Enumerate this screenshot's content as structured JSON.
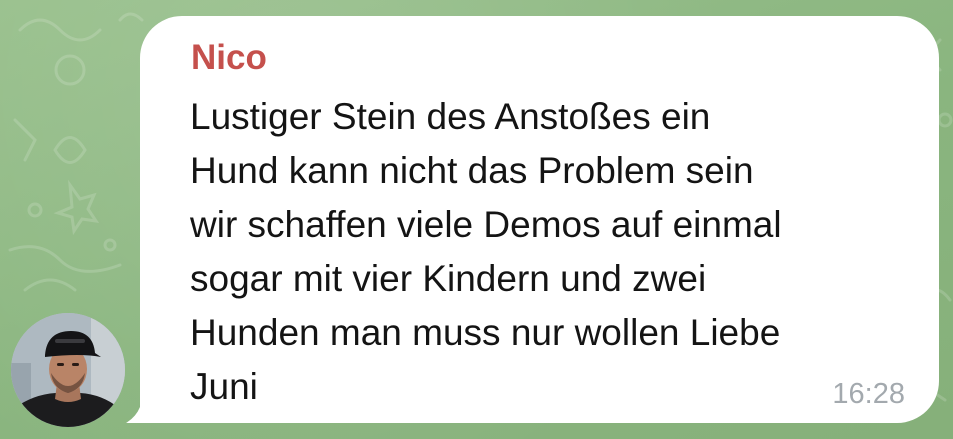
{
  "chat": {
    "background_color": "#8fb886"
  },
  "message": {
    "sender": "Nico",
    "sender_color": "#c5504c",
    "text": "Lustiger Stein des Anstoßes ein\nHund kann nicht das Problem sein\nwir schaffen viele Demos auf einmal\nsogar mit vier Kindern und zwei\nHunden man muss nur wollen Liebe\nJuni",
    "time": "16:28"
  },
  "avatar": {
    "icon": "user-photo-avatar"
  }
}
